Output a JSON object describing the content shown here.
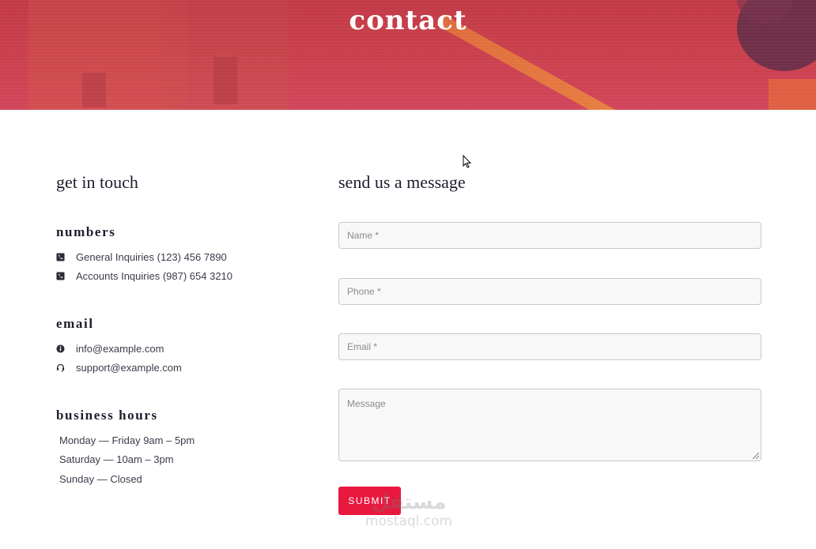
{
  "hero": {
    "title": "contact"
  },
  "contact_info": {
    "heading": "get in touch",
    "numbers": {
      "heading": "numbers",
      "items": [
        {
          "icon": "phone-square-icon",
          "text": "General Inquiries (123) 456 7890"
        },
        {
          "icon": "phone-square-icon",
          "text": "Accounts Inquiries (987) 654 3210"
        }
      ]
    },
    "email": {
      "heading": "email",
      "items": [
        {
          "icon": "info-circle-icon",
          "text": "info@example.com"
        },
        {
          "icon": "headset-icon",
          "text": "support@example.com"
        }
      ]
    },
    "hours": {
      "heading": "business hours",
      "items": [
        "Monday — Friday 9am – 5pm",
        "Saturday — 10am – 3pm",
        "Sunday — Closed"
      ]
    }
  },
  "form": {
    "heading": "send us a message",
    "name_placeholder": "Name *",
    "phone_placeholder": "Phone *",
    "email_placeholder": "Email *",
    "message_placeholder": "Message",
    "submit_label": "SUBMIT"
  },
  "watermark": {
    "arabic": "مستقل",
    "latin": "mostaql.com"
  },
  "colors": {
    "accent": "#e8183f",
    "heading": "#1d1d2c",
    "text": "#3b3b4a"
  }
}
